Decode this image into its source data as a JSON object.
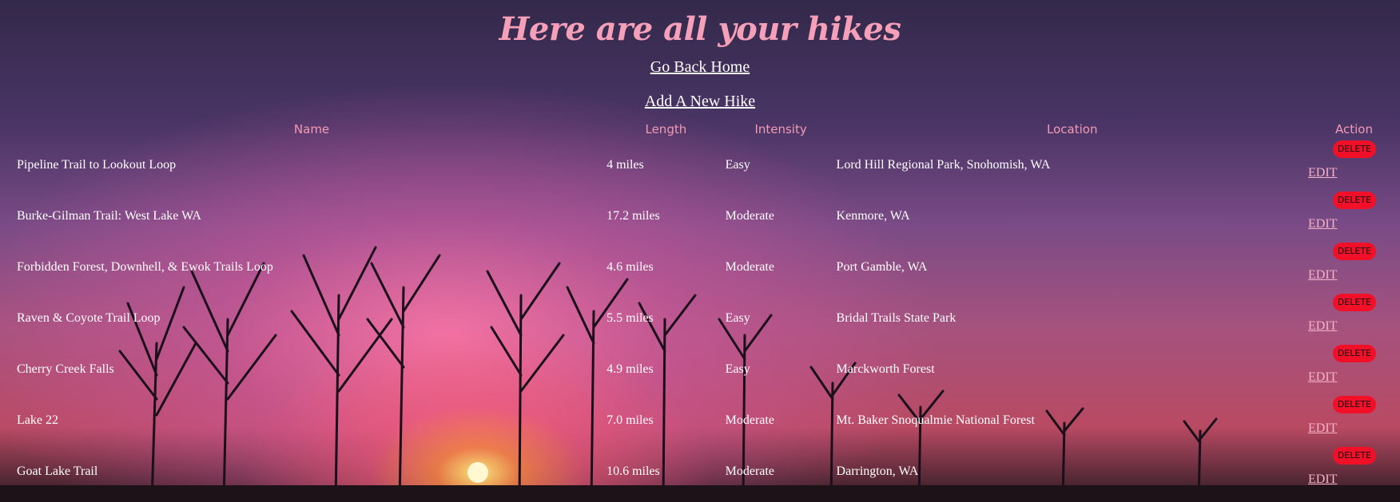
{
  "page": {
    "title": "Here are all your hikes",
    "nav": {
      "home_label": "Go Back Home",
      "add_label": "Add A New Hike"
    },
    "colors": {
      "title": "#f5a0b8",
      "header": "#f39ab4",
      "delete_button": "#f21028",
      "edit_link": "#f6b3c7"
    }
  },
  "table": {
    "headers": {
      "name": "Name",
      "length": "Length",
      "intensity": "Intensity",
      "location": "Location",
      "action": "Action"
    },
    "delete_label": "DELETE",
    "edit_label": "EDIT",
    "rows": [
      {
        "name": "Pipeline Trail to Lookout Loop",
        "length": "4 miles",
        "intensity": "Easy",
        "location": "Lord Hill Regional Park, Snohomish, WA"
      },
      {
        "name": "Burke-Gilman Trail: West Lake WA",
        "length": "17.2 miles",
        "intensity": "Moderate",
        "location": "Kenmore, WA"
      },
      {
        "name": "Forbidden Forest, Downhell, & Ewok Trails Loop",
        "length": "4.6 miles",
        "intensity": "Moderate",
        "location": "Port Gamble, WA"
      },
      {
        "name": "Raven & Coyote Trail Loop",
        "length": "5.5 miles",
        "intensity": "Easy",
        "location": "Bridal Trails State Park"
      },
      {
        "name": "Cherry Creek Falls",
        "length": "4.9 miles",
        "intensity": "Easy",
        "location": "Marckworth Forest"
      },
      {
        "name": "Lake 22",
        "length": "7.0 miles",
        "intensity": "Moderate",
        "location": "Mt. Baker Snoqualmie National Forest"
      },
      {
        "name": "Goat Lake Trail",
        "length": "10.6 miles",
        "intensity": "Moderate",
        "location": "Darrington, WA"
      }
    ]
  }
}
